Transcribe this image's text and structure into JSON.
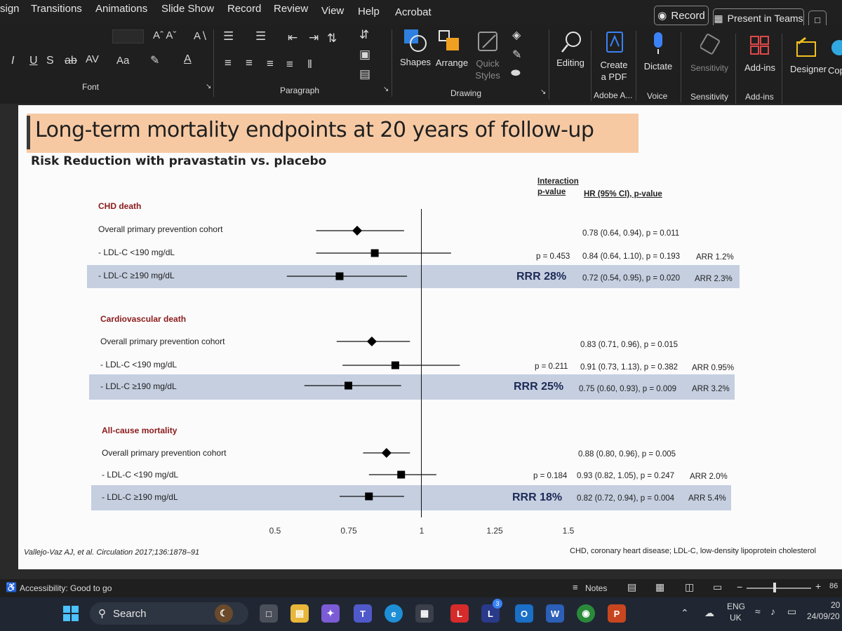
{
  "menubar": {
    "items": [
      "sign",
      "Transitions",
      "Animations",
      "Slide Show",
      "Record",
      "Review",
      "View",
      "Help",
      "Acrobat"
    ],
    "record_label": "Record",
    "teams_label": "Present in Teams"
  },
  "ribbon": {
    "groups": {
      "font": "Font",
      "paragraph": "Paragraph",
      "drawing": "Drawing",
      "adobe": "Adobe A...",
      "voice": "Voice",
      "sensitivity": "Sensitivity",
      "addins": "Add-ins"
    },
    "buttons": {
      "shapes": "Shapes",
      "arrange": "Arrange",
      "quick_styles_1": "Quick",
      "quick_styles_2": "Styles",
      "editing": "Editing",
      "create_pdf_1": "Create",
      "create_pdf_2": "a PDF",
      "dictate": "Dictate",
      "sensitivity": "Sensitivity",
      "addins": "Add-ins",
      "designer": "Designer",
      "copilot": "Cop"
    },
    "font_format_letters": [
      "I",
      "U",
      "S",
      "ab",
      "AV",
      "Aa"
    ]
  },
  "slide": {
    "title": "Long-term mortality endpoints at 20 years of follow-up",
    "subtitle": "Risk Reduction with pravastatin vs. placebo",
    "header_interaction_1": "Interaction",
    "header_interaction_2": "p-value",
    "header_hr": "HR (95% CI), p-value",
    "footer_left": "Vallejo-Vaz AJ, et al. Circulation 2017;136:1878–91",
    "footer_right": "CHD, coronary heart disease; LDL-C, low-density lipoprotein cholesterol"
  },
  "chart_data": {
    "type": "forest",
    "xlim": [
      0.5,
      1.5
    ],
    "reference_line": 1,
    "ticks": [
      "0.5",
      "0.75",
      "1",
      "1.25",
      "1.5"
    ],
    "sections": [
      {
        "title": "CHD death",
        "rrr": "RRR 28%",
        "rows": [
          {
            "label": "Overall primary prevention cohort",
            "hr": 0.78,
            "lo": 0.64,
            "hi": 0.94,
            "text": "0.78 (0.64, 0.94), p = 0.011",
            "interaction": "",
            "arr": "",
            "marker": "diamond",
            "highlight": false
          },
          {
            "label": "- LDL-C <190 mg/dL",
            "hr": 0.84,
            "lo": 0.64,
            "hi": 1.1,
            "text": "0.84 (0.64, 1.10), p = 0.193",
            "interaction": "p = 0.453",
            "arr": "ARR 1.2%",
            "marker": "square",
            "highlight": false
          },
          {
            "label": "- LDL-C ≥190 mg/dL",
            "hr": 0.72,
            "lo": 0.54,
            "hi": 0.95,
            "text": "0.72 (0.54, 0.95), p = 0.020",
            "interaction": "",
            "arr": "ARR 2.3%",
            "marker": "square",
            "highlight": true
          }
        ]
      },
      {
        "title": "Cardiovascular death",
        "rrr": "RRR 25%",
        "rows": [
          {
            "label": "Overall primary prevention cohort",
            "hr": 0.83,
            "lo": 0.71,
            "hi": 0.96,
            "text": "0.83 (0.71, 0.96), p = 0.015",
            "interaction": "",
            "arr": "",
            "marker": "diamond",
            "highlight": false
          },
          {
            "label": "- LDL-C <190 mg/dL",
            "hr": 0.91,
            "lo": 0.73,
            "hi": 1.13,
            "text": "0.91 (0.73, 1.13), p = 0.382",
            "interaction": "p = 0.211",
            "arr": "ARR 0.95%",
            "marker": "square",
            "highlight": false
          },
          {
            "label": "- LDL-C ≥190 mg/dL",
            "hr": 0.75,
            "lo": 0.6,
            "hi": 0.93,
            "text": "0.75 (0.60, 0.93), p = 0.009",
            "interaction": "",
            "arr": "ARR 3.2%",
            "marker": "square",
            "highlight": true
          }
        ]
      },
      {
        "title": "All-cause mortality",
        "rrr": "RRR 18%",
        "rows": [
          {
            "label": "Overall primary prevention cohort",
            "hr": 0.88,
            "lo": 0.8,
            "hi": 0.96,
            "text": "0.88 (0.80, 0.96), p = 0.005",
            "interaction": "",
            "arr": "",
            "marker": "diamond",
            "highlight": false
          },
          {
            "label": "- LDL-C <190 mg/dL",
            "hr": 0.93,
            "lo": 0.82,
            "hi": 1.05,
            "text": "0.93 (0.82, 1.05), p = 0.247",
            "interaction": "p = 0.184",
            "arr": "ARR 2.0%",
            "marker": "square",
            "highlight": false
          },
          {
            "label": "- LDL-C ≥190 mg/dL",
            "hr": 0.82,
            "lo": 0.72,
            "hi": 0.94,
            "text": "0.82 (0.72, 0.94), p = 0.004",
            "interaction": "",
            "arr": "ARR 5.4%",
            "marker": "square",
            "highlight": true
          }
        ]
      }
    ]
  },
  "statusbar": {
    "accessibility": "Accessibility: Good to go",
    "notes": "Notes",
    "zoom": "86"
  },
  "taskbar": {
    "search_placeholder": "Search",
    "lang_1": "ENG",
    "lang_2": "UK",
    "clock_time": "20",
    "clock_date": "24/09/20",
    "badge": "3"
  }
}
